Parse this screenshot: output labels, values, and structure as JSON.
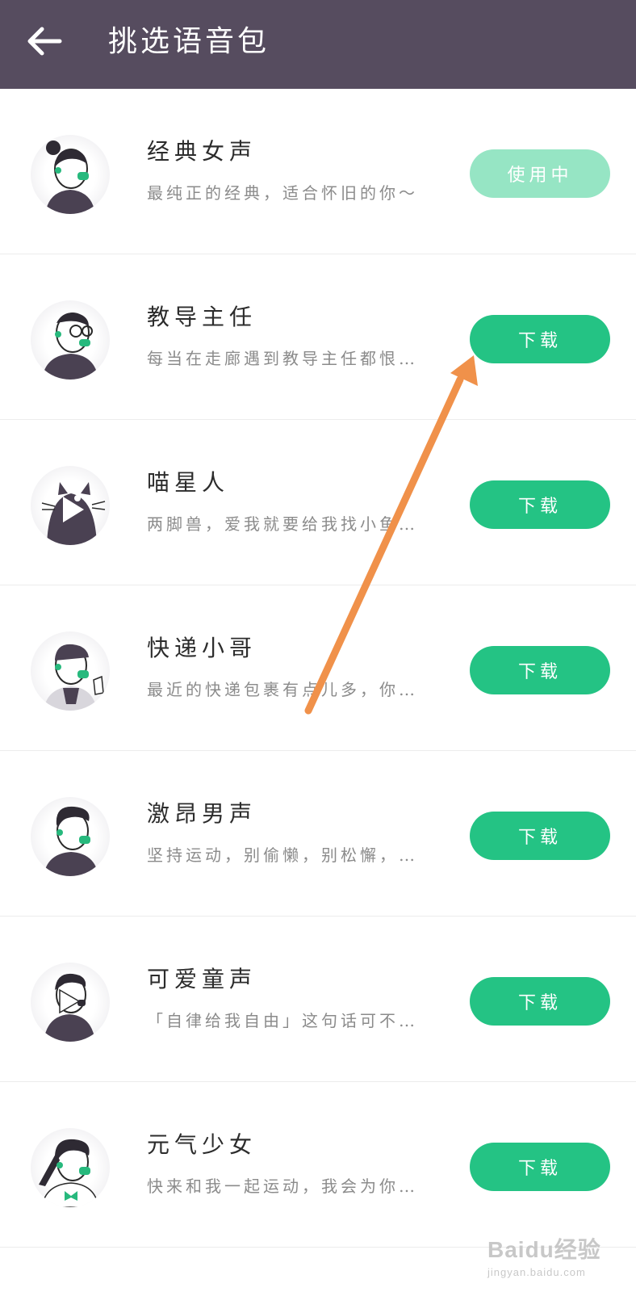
{
  "header": {
    "title": "挑选语音包",
    "back_icon": "back-arrow-icon",
    "background": "#564c5f"
  },
  "colors": {
    "download": "#24c384",
    "in_use": "#96e5c4",
    "annotation_arrow": "#f0914a"
  },
  "voice_packs": [
    {
      "name": "经典女声",
      "desc": "最纯正的经典，适合怀旧的你～",
      "action": "使用中",
      "state": "in-use",
      "avatar": "classic-female-avatar-icon"
    },
    {
      "name": "教导主任",
      "desc": "每当在走廊遇到教导主任都恨…",
      "action": "下载",
      "state": "download",
      "avatar": "dean-avatar-icon"
    },
    {
      "name": "喵星人",
      "desc": "两脚兽，爱我就要给我找小鱼…",
      "action": "下载",
      "state": "download",
      "avatar": "cat-avatar-icon"
    },
    {
      "name": "快递小哥",
      "desc": "最近的快递包裹有点儿多，你…",
      "action": "下载",
      "state": "download",
      "avatar": "courier-avatar-icon"
    },
    {
      "name": "激昂男声",
      "desc": "坚持运动，别偷懒，别松懈，…",
      "action": "下载",
      "state": "download",
      "avatar": "passionate-male-avatar-icon"
    },
    {
      "name": "可爱童声",
      "desc": "「自律给我自由」这句话可不…",
      "action": "下载",
      "state": "download",
      "avatar": "child-avatar-icon"
    },
    {
      "name": "元气少女",
      "desc": "快来和我一起运动，我会为你…",
      "action": "下载",
      "state": "download",
      "avatar": "energetic-girl-avatar-icon"
    }
  ],
  "watermark": {
    "logo": "Baidu经验",
    "url": "jingyan.baidu.com"
  }
}
